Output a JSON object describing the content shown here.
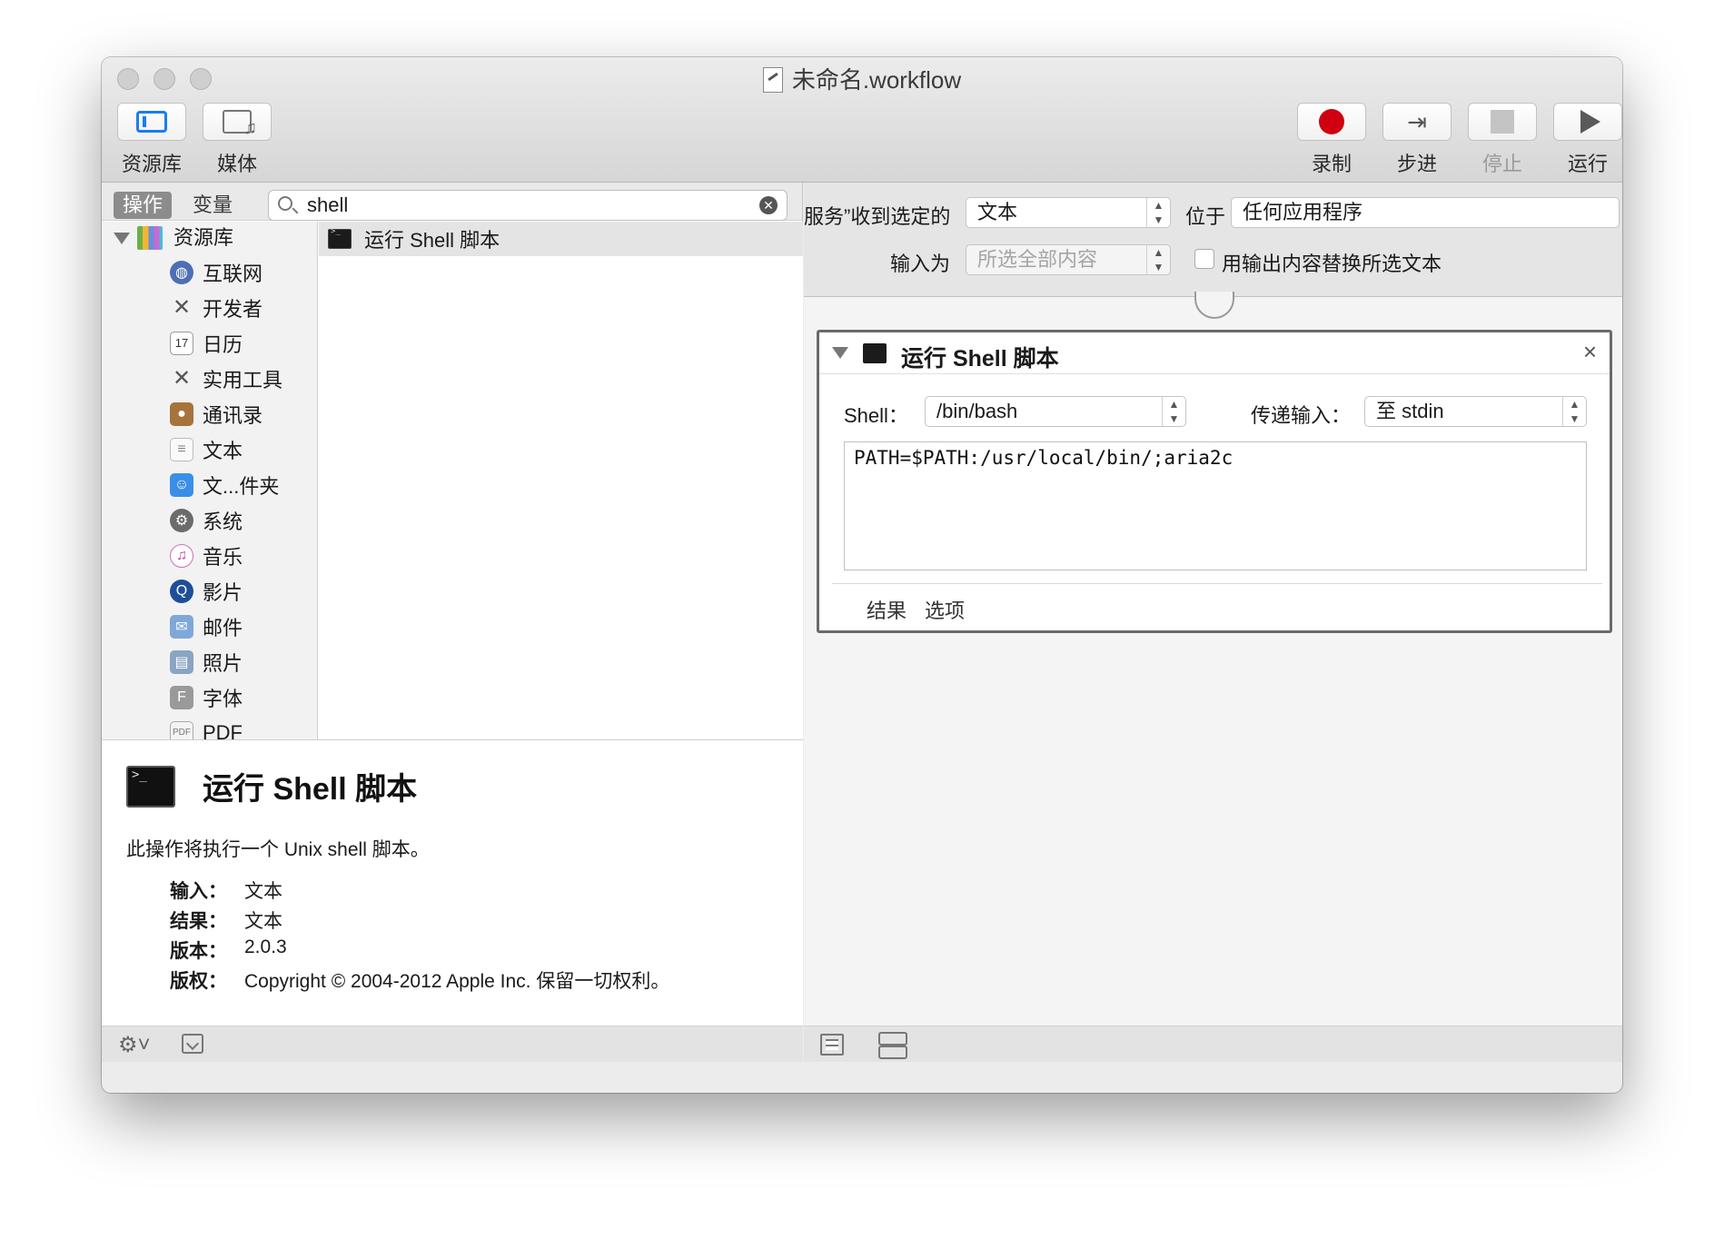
{
  "window": {
    "title": "未命名.workflow"
  },
  "toolbar": {
    "library_label": "资源库",
    "media_label": "媒体",
    "record_label": "录制",
    "step_label": "步进",
    "stop_label": "停止",
    "run_label": "运行",
    "record_color": "#cf0010"
  },
  "library": {
    "segment_actions": "操作",
    "segment_variables": "变量",
    "search_value": "shell",
    "root_label": "资源库",
    "categories": [
      {
        "label": "互联网",
        "icon": "globe-icon"
      },
      {
        "label": "开发者",
        "icon": "tools-icon"
      },
      {
        "label": "日历",
        "icon": "calendar-icon"
      },
      {
        "label": "实用工具",
        "icon": "utilities-icon"
      },
      {
        "label": "通讯录",
        "icon": "contacts-icon"
      },
      {
        "label": "文本",
        "icon": "text-icon"
      },
      {
        "label": "文...件夹",
        "icon": "finder-icon"
      },
      {
        "label": "系统",
        "icon": "system-icon"
      },
      {
        "label": "音乐",
        "icon": "music-icon"
      },
      {
        "label": "影片",
        "icon": "movie-icon"
      },
      {
        "label": "邮件",
        "icon": "mail-icon"
      },
      {
        "label": "照片",
        "icon": "photos-icon"
      },
      {
        "label": "字体",
        "icon": "font-icon"
      },
      {
        "label": "PDF",
        "icon": "pdf-icon"
      }
    ],
    "results": [
      {
        "label": "运行 Shell 脚本"
      }
    ]
  },
  "description": {
    "title": "运行 Shell 脚本",
    "text": "此操作将执行一个 Unix shell 脚本。",
    "input_key": "输入：",
    "input_value": "文本",
    "result_key": "结果：",
    "result_value": "文本",
    "version_key": "版本：",
    "version_value": "2.0.3",
    "copyright_key": "版权：",
    "copyright_value": "Copyright © 2004-2012 Apple Inc. 保留一切权利。"
  },
  "service": {
    "receives_label": "服务”收到选定的",
    "receives_value": "文本",
    "in_label": "位于",
    "in_value": "任何应用程序",
    "input_is_label": "输入为",
    "input_is_value": "所选全部内容",
    "replace_label": "用输出内容替换所选文本"
  },
  "action": {
    "title": "运行 Shell 脚本",
    "shell_label": "Shell：",
    "shell_value": "/bin/bash",
    "pass_input_label": "传递输入：",
    "pass_input_value": "至 stdin",
    "script": "PATH=$PATH:/usr/local/bin/;aria2c",
    "tab_results": "结果",
    "tab_options": "选项"
  }
}
